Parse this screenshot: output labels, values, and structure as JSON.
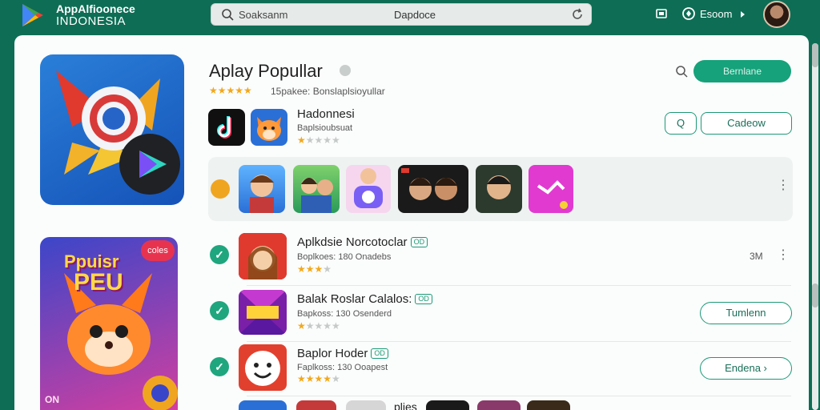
{
  "topbar": {
    "brand_line1": "AppAlfioonece",
    "brand_line2": "INDONESIA",
    "search_placeholder": "Soaksanm",
    "search_center_text": "Dapdoce",
    "account_label": "Esoom"
  },
  "header": {
    "title": "Aplay Popullar",
    "rating_text": "15pakee: Bonslaplsioyullar",
    "primary_button": "Bernlane"
  },
  "featured": {
    "title": "Hadonnesi",
    "subtitle": "Baplsioubsuat",
    "search_button": "Q",
    "action_button": "Cadeow"
  },
  "promo": {
    "badge": "coles",
    "title_line1": "Ppuisr",
    "title_line2": "PEU",
    "tag": "ON"
  },
  "rows": [
    {
      "title": "Aplkdsie Norcotoclar",
      "chip": "OD",
      "subtitle": "Boplkoes: 180 Onadebs",
      "trailing": "3M",
      "button": ""
    },
    {
      "title": "Balak Roslar Calalos:",
      "chip": "OD",
      "subtitle": "Bapkoss: 130 Osenderd",
      "trailing": "",
      "button": "Tumlenn"
    },
    {
      "title": "Baplor Hoder",
      "chip": "OD",
      "subtitle": "Faplkoss: 130 Ooapest",
      "trailing": "",
      "button": "Endena ›"
    }
  ],
  "bottom_text": "plies",
  "colors": {
    "header_green": "#0e6d55",
    "accent": "#16a27b",
    "star": "#f2a81c"
  },
  "icons": [
    "play-store-logo",
    "search-icon",
    "reload-icon",
    "window-icon",
    "globe-icon",
    "chevron-down-icon",
    "kebab-menu-icon",
    "check-icon",
    "info-icon"
  ]
}
